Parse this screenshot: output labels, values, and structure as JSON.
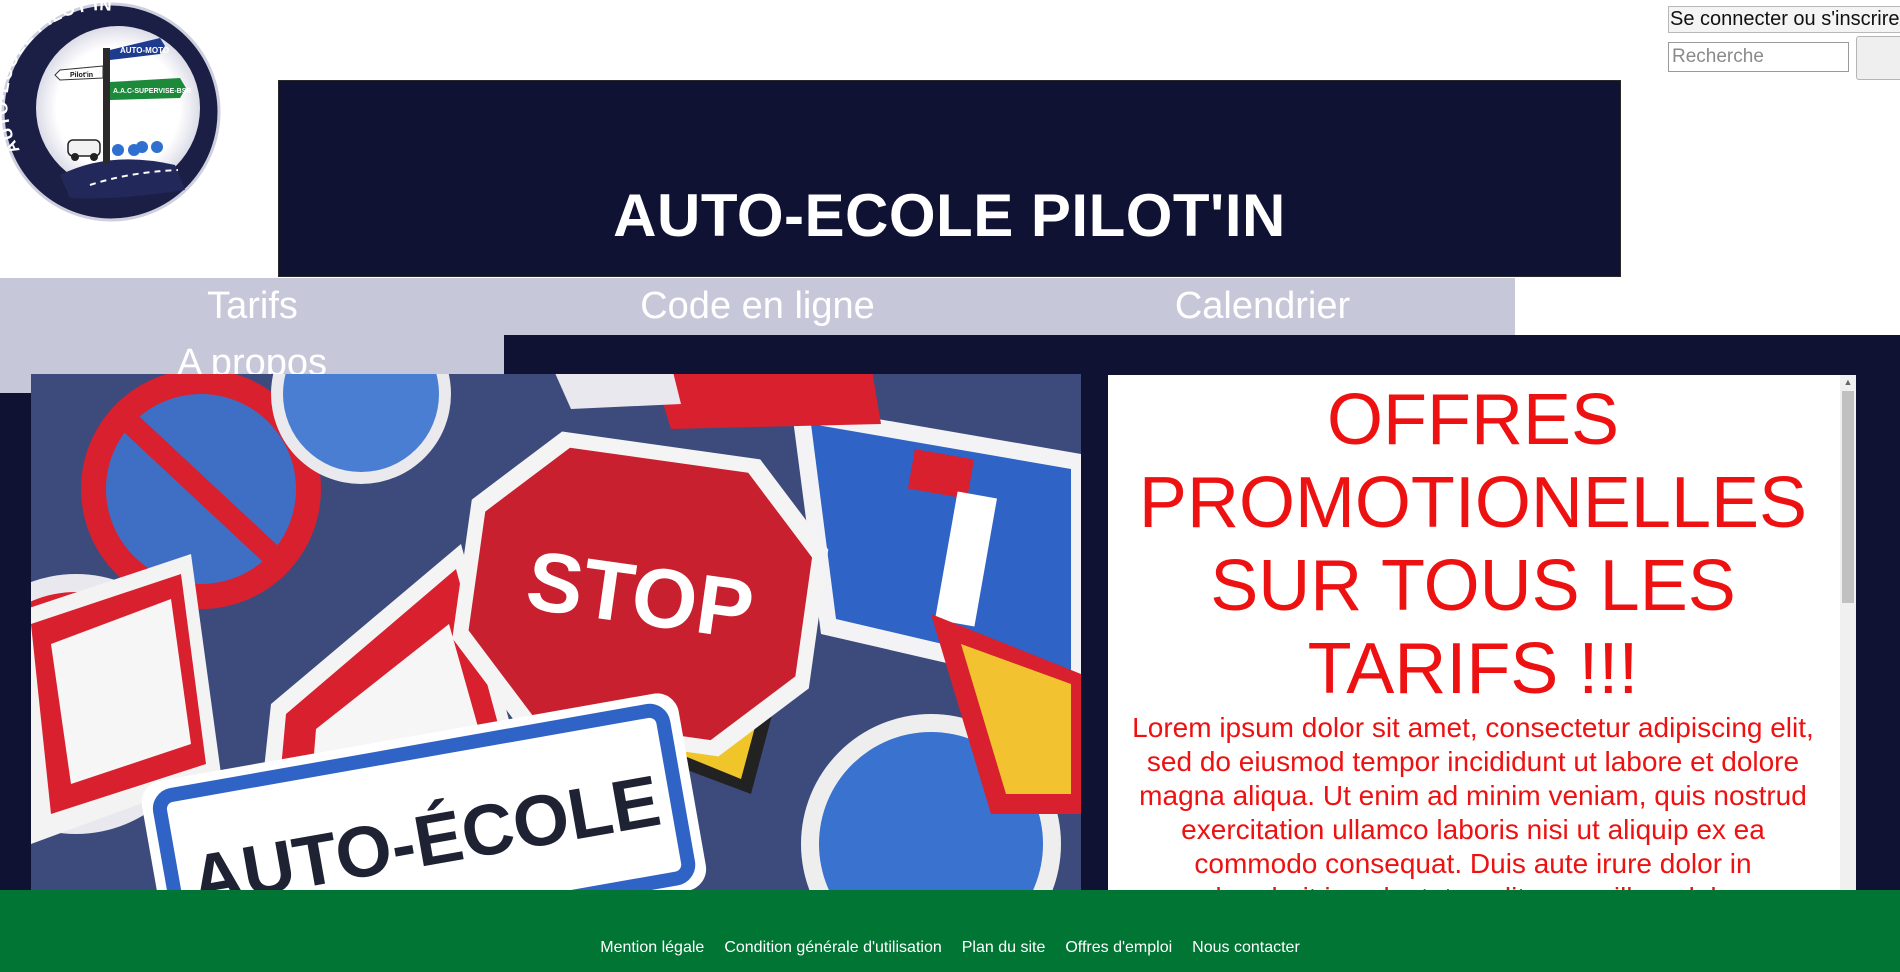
{
  "header": {
    "auth_label": "Se connecter ou s'inscrire",
    "search_placeholder": "Recherche",
    "title": "AUTO-ECOLE PILOT'IN",
    "logo": {
      "ring_text": "AUTO-ECOLE PILOT'IN",
      "sign_1": "AUTO-MOTO",
      "sign_2": "Pilot'in",
      "sign_3": "A.A.C-SUPERVISE-BSR"
    }
  },
  "nav": {
    "items": [
      {
        "label": "Tarifs"
      },
      {
        "label": "Code en ligne"
      },
      {
        "label": "Calendrier"
      },
      {
        "label": "A propos"
      }
    ]
  },
  "hero": {
    "stop_text": "STOP",
    "auto_ecole_text": "AUTO-ÉCOLE"
  },
  "promo": {
    "title": "OFFRES PROMOTIONELLES SUR TOUS LES TARIFS !!!",
    "body": "Lorem ipsum dolor sit amet, consectetur adipiscing elit, sed do eiusmod tempor incididunt ut labore et dolore magna aliqua. Ut enim ad minim veniam, quis nostrud exercitation ullamco laboris nisi ut aliquip ex ea commodo consequat. Duis aute irure dolor in reprehenderit in voluptate velit esse cillum dolore eu"
  },
  "footer": {
    "links": [
      {
        "label": "Mention légale"
      },
      {
        "label": "Condition générale d'utilisation"
      },
      {
        "label": "Plan du site"
      },
      {
        "label": "Offres d'emploi"
      },
      {
        "label": "Nous contacter"
      }
    ]
  },
  "colors": {
    "banner": "#101233",
    "nav": "#c6c7d9",
    "promo_text": "#ee1111",
    "footer": "#007534"
  }
}
